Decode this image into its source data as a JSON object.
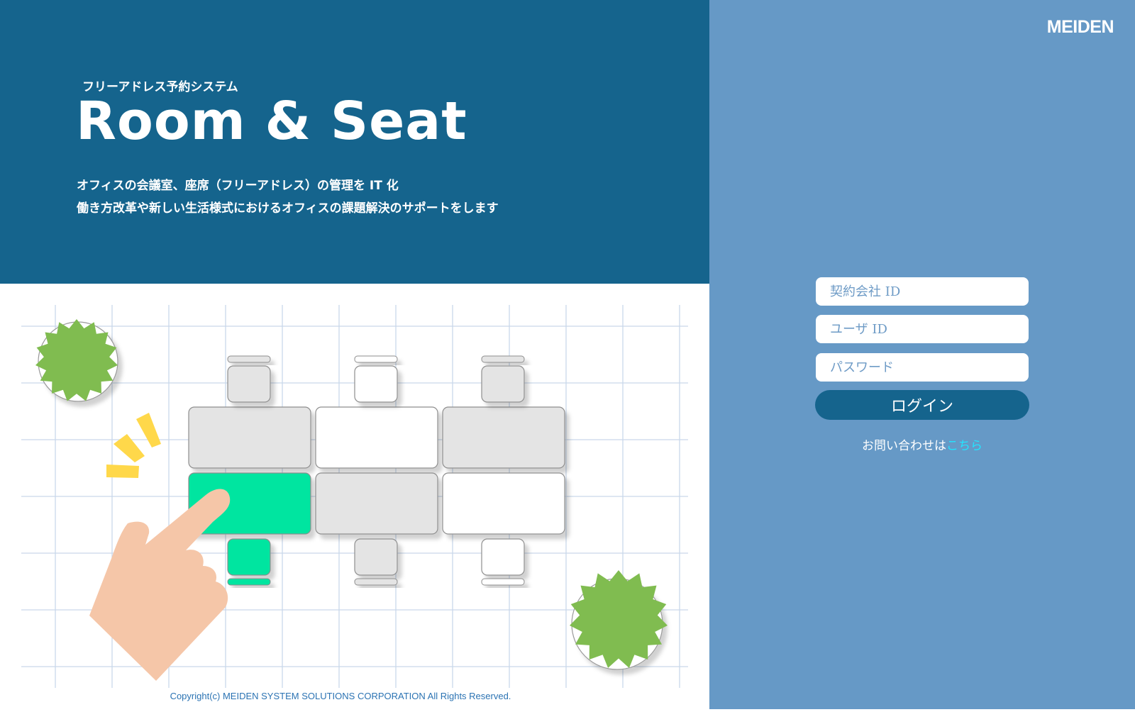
{
  "hero": {
    "subtitle": "フリーアドレス予約システム",
    "title": "Room & Seat",
    "description_line1": "オフィスの会議室、座席（フリーアドレス）の管理を IT 化",
    "description_line2": "働き方改革や新しい生活様式におけるオフィスの課題解決のサポートをします"
  },
  "brand": {
    "logo_text": "MEIDEN"
  },
  "login": {
    "company_id_placeholder": "契約会社 ID",
    "user_id_placeholder": "ユーザ ID",
    "password_placeholder": "パスワード",
    "login_label": "ログイン",
    "contact_text": "お問い合わせは",
    "contact_link": "こちら"
  },
  "footer": {
    "copyright": "Copyright(c) MEIDEN SYSTEM SOLUTIONS CORPORATION All Rights Reserved."
  },
  "colors": {
    "hero_bg": "#15648d",
    "side_bg": "#6699c6",
    "button_bg": "#15648d",
    "link": "#23e4ff",
    "selected_seat": "#00e5a0",
    "plant": "#80bc50",
    "sparkle": "#ffd84a",
    "hand": "#f5c6a8"
  }
}
